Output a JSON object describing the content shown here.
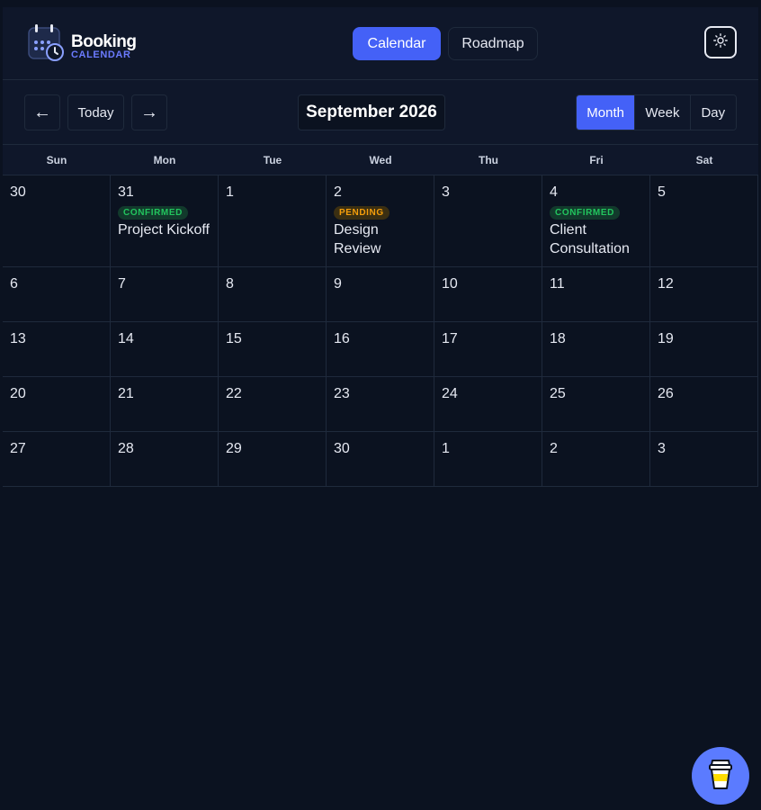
{
  "brand": {
    "title": "Booking",
    "subtitle": "CALENDAR",
    "logo_icon": "calendar-clock-icon"
  },
  "nav": {
    "items": [
      {
        "label": "Calendar",
        "active": true
      },
      {
        "label": "Roadmap",
        "active": false
      }
    ]
  },
  "theme_toggle": {
    "icon": "sun-icon"
  },
  "toolbar": {
    "prev_label": "←",
    "today_label": "Today",
    "next_label": "→",
    "month_title": "September 2026",
    "views": [
      {
        "label": "Month",
        "active": true
      },
      {
        "label": "Week",
        "active": false
      },
      {
        "label": "Day",
        "active": false
      }
    ]
  },
  "calendar": {
    "weekdays": [
      "Sun",
      "Mon",
      "Tue",
      "Wed",
      "Thu",
      "Fri",
      "Sat"
    ],
    "weeks": [
      [
        {
          "day": "30",
          "events": []
        },
        {
          "day": "31",
          "events": [
            {
              "status": "CONFIRMED",
              "title": "Project Kickoff"
            }
          ]
        },
        {
          "day": "1",
          "events": []
        },
        {
          "day": "2",
          "events": [
            {
              "status": "PENDING",
              "title": "Design Review"
            }
          ]
        },
        {
          "day": "3",
          "events": []
        },
        {
          "day": "4",
          "events": [
            {
              "status": "CONFIRMED",
              "title": "Client Consultation"
            }
          ]
        },
        {
          "day": "5",
          "events": []
        }
      ],
      [
        {
          "day": "6",
          "events": []
        },
        {
          "day": "7",
          "events": []
        },
        {
          "day": "8",
          "events": []
        },
        {
          "day": "9",
          "events": []
        },
        {
          "day": "10",
          "events": []
        },
        {
          "day": "11",
          "events": []
        },
        {
          "day": "12",
          "events": []
        }
      ],
      [
        {
          "day": "13",
          "events": []
        },
        {
          "day": "14",
          "events": []
        },
        {
          "day": "15",
          "events": []
        },
        {
          "day": "16",
          "events": []
        },
        {
          "day": "17",
          "events": []
        },
        {
          "day": "18",
          "events": []
        },
        {
          "day": "19",
          "events": []
        }
      ],
      [
        {
          "day": "20",
          "events": []
        },
        {
          "day": "21",
          "events": []
        },
        {
          "day": "22",
          "events": []
        },
        {
          "day": "23",
          "events": []
        },
        {
          "day": "24",
          "events": []
        },
        {
          "day": "25",
          "events": []
        },
        {
          "day": "26",
          "events": []
        }
      ],
      [
        {
          "day": "27",
          "events": []
        },
        {
          "day": "28",
          "events": []
        },
        {
          "day": "29",
          "events": []
        },
        {
          "day": "30",
          "events": []
        },
        {
          "day": "1",
          "events": []
        },
        {
          "day": "2",
          "events": []
        },
        {
          "day": "3",
          "events": []
        }
      ]
    ]
  },
  "fab": {
    "icon": "coffee-cup-icon"
  },
  "colors": {
    "accent": "#4461f7",
    "confirmed": "#22c55e",
    "pending": "#f59e0b",
    "background": "#0b1220"
  }
}
